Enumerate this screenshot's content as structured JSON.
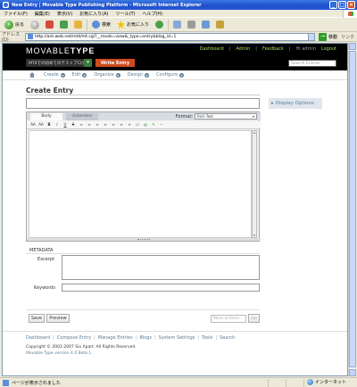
{
  "window": {
    "title": "New Entry | Movable Type Publishing Platform - Microsoft Internet Explorer",
    "controls": [
      "_",
      "□",
      "×"
    ]
  },
  "ie_menu": [
    "ファイル(F)",
    "編集(E)",
    "表示(V)",
    "お気に入り(A)",
    "ツール(T)",
    "ヘルプ(H)"
  ],
  "ie_toolbar": {
    "back": "戻る",
    "search": "検索",
    "favorites": "お気に入り"
  },
  "address": {
    "label": "アドレス(D)",
    "url": "http://ark-web.net/mt4/mt.cgi?__mode=view&_type=entry&blog_id=1",
    "go": "移動",
    "links": "リンク"
  },
  "mt": {
    "logo": {
      "light": "MOVABLE",
      "bold": "TYPE"
    },
    "toplinks": [
      "Dashboard",
      "Admin",
      "Feedback",
      "Hi admin",
      "Logout"
    ],
    "blog_name": "MT4での初めてのテストブログ",
    "write_label": "Write Entry",
    "search_placeholder": "Search Entries",
    "nav": [
      "Create",
      "Edit",
      "Organize",
      "Design",
      "Configure"
    ]
  },
  "main": {
    "title": "Create Entry",
    "display_options": "Display Options",
    "tabs": [
      "Body",
      "Extended"
    ],
    "format_label": "Format:",
    "format_value": "Rich Text",
    "editor_buttons": [
      "AA",
      "AA",
      "B",
      "I",
      "U",
      "S",
      "∞",
      "≡",
      "≡",
      "≡",
      "≡",
      "≡",
      "≡",
      "☐",
      "▤",
      "✎",
      "~"
    ],
    "metadata_label": "METADATA",
    "excerpt_label": "Excerpt",
    "keywords_label": "Keywords",
    "save_label": "Save",
    "preview_label": "Preview",
    "more_actions": "More actions...",
    "go_label": "Go"
  },
  "footer": {
    "links": [
      "Dashboard",
      "Compose Entry",
      "Manage Entries",
      "Blogs",
      "System Settings",
      "Tools",
      "Search"
    ],
    "copyright": "Copyright © 2001-2007 Six Apart. All Rights Reserved.",
    "version": "Movable Type version 4.0 Beta 1"
  },
  "status": {
    "text": "ページが表示されました",
    "zone": "インターネット"
  }
}
